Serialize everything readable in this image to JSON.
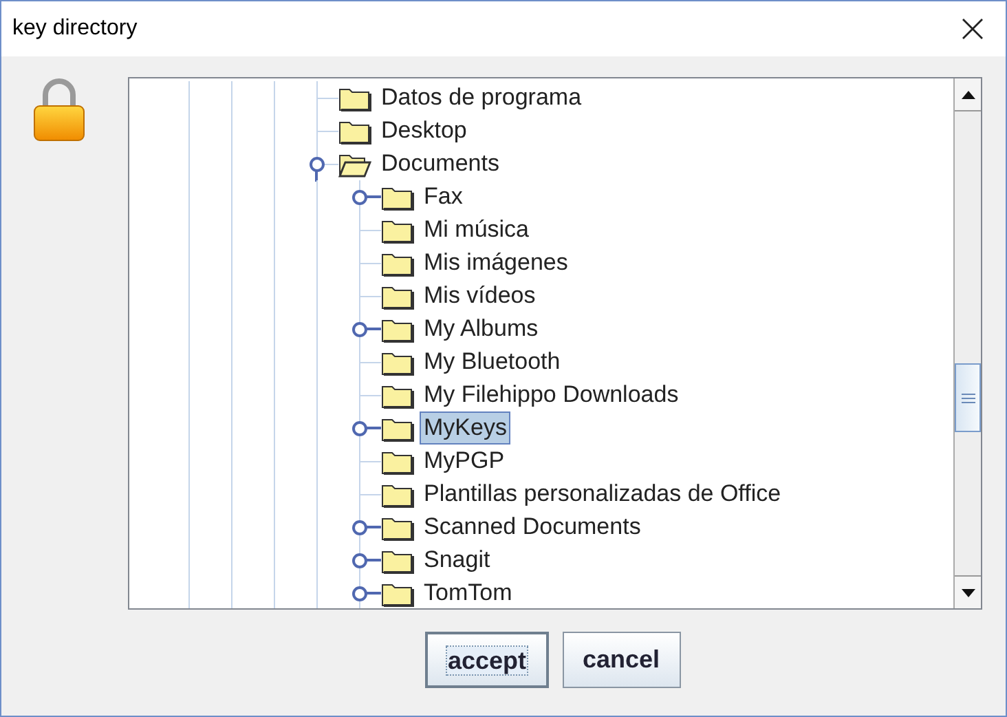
{
  "window": {
    "title": "key directory"
  },
  "tree": {
    "children": [
      {
        "label": "Datos de programa",
        "kind": "leaf",
        "selected": false
      },
      {
        "label": "Desktop",
        "kind": "leaf",
        "selected": false
      },
      {
        "label": "Documents",
        "kind": "node",
        "expanded": true,
        "selected": false,
        "children": [
          {
            "label": "Fax",
            "kind": "node",
            "expanded": false,
            "selected": false
          },
          {
            "label": "Mi música",
            "kind": "leaf",
            "selected": false
          },
          {
            "label": "Mis imágenes",
            "kind": "leaf",
            "selected": false
          },
          {
            "label": "Mis vídeos",
            "kind": "leaf",
            "selected": false
          },
          {
            "label": "My Albums",
            "kind": "node",
            "expanded": false,
            "selected": false
          },
          {
            "label": "My Bluetooth",
            "kind": "leaf",
            "selected": false
          },
          {
            "label": "My Filehippo Downloads",
            "kind": "leaf",
            "selected": false
          },
          {
            "label": "MyKeys",
            "kind": "node",
            "expanded": false,
            "selected": true
          },
          {
            "label": "MyPGP",
            "kind": "leaf",
            "selected": false
          },
          {
            "label": "Plantillas personalizadas de Office",
            "kind": "leaf",
            "selected": false
          },
          {
            "label": "Scanned Documents",
            "kind": "node",
            "expanded": false,
            "selected": false
          },
          {
            "label": "Snagit",
            "kind": "node",
            "expanded": false,
            "selected": false
          },
          {
            "label": "TomTom",
            "kind": "node",
            "expanded": false,
            "selected": false
          }
        ]
      }
    ]
  },
  "buttons": [
    {
      "label": "accept",
      "focused": true
    },
    {
      "label": "cancel",
      "focused": false
    }
  ]
}
